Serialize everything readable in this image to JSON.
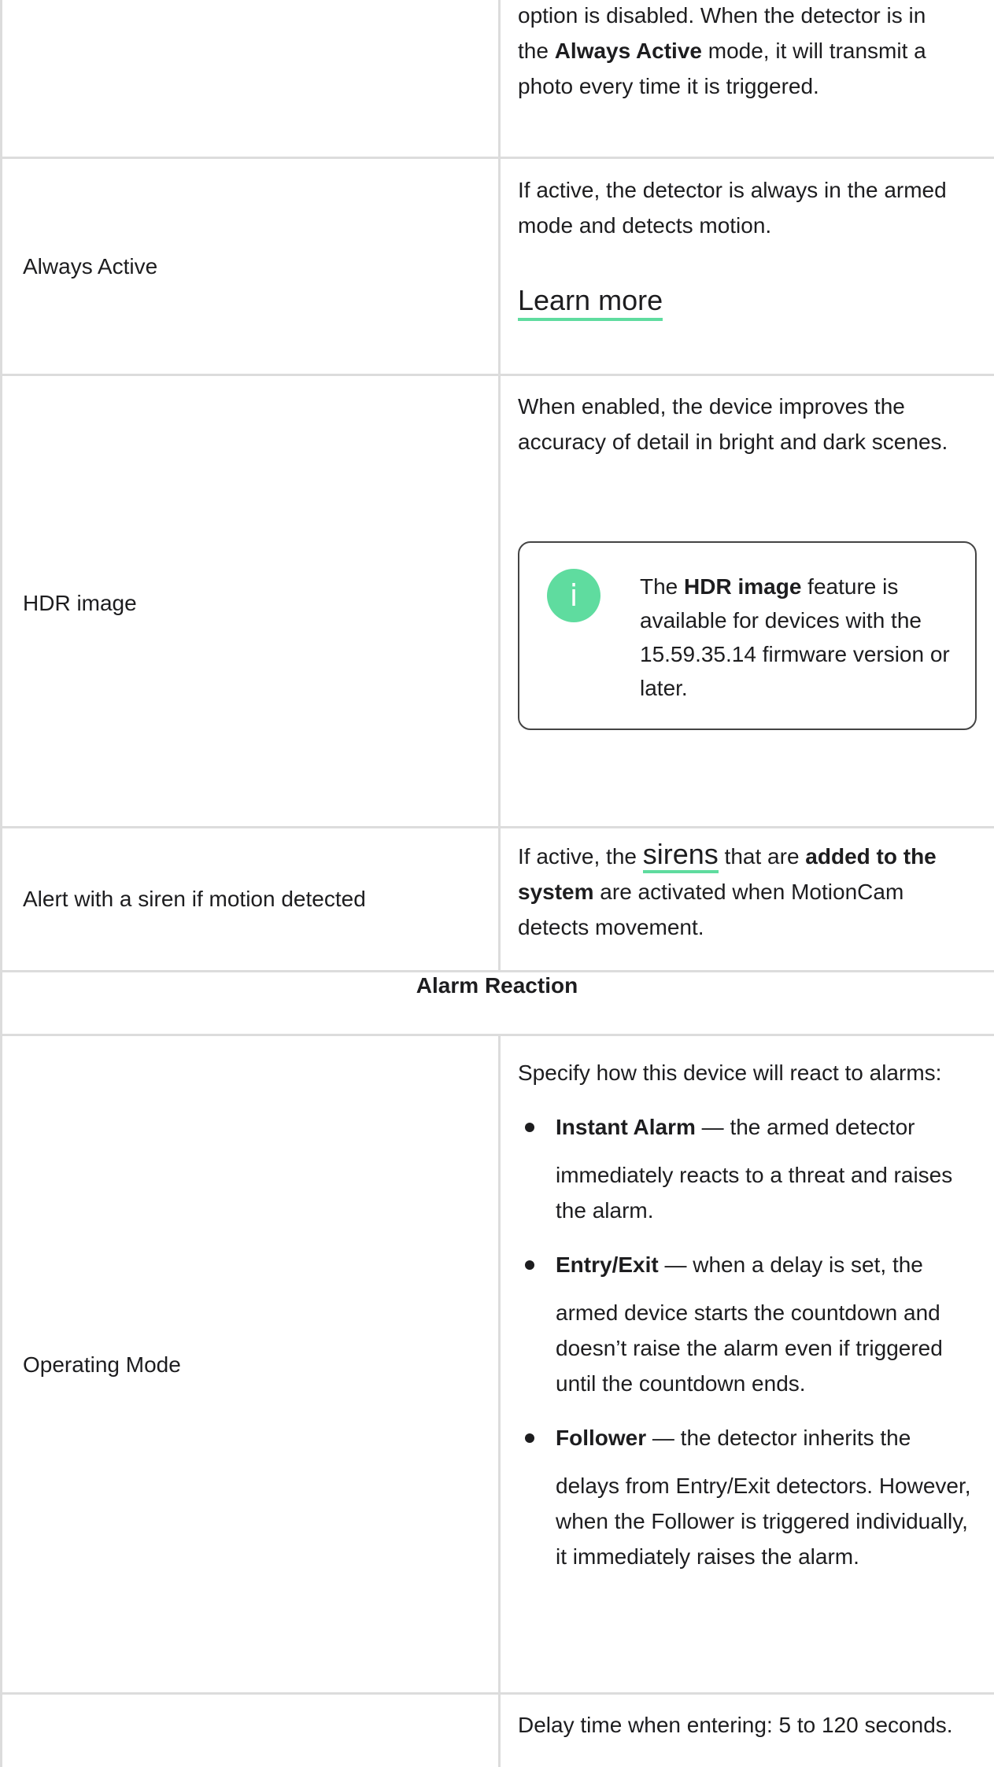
{
  "row_photo_transmission": {
    "desc_line1": "option is disabled. When the detector is in",
    "desc_line2_pre": "the ",
    "desc_line2_bold": "Always Active",
    "desc_line2_post": " mode, it will transmit a",
    "desc_line3": "photo every time it is triggered."
  },
  "row_always_active": {
    "label": "Always Active",
    "desc": "If active, the detector is always in the armed mode and detects motion.",
    "link": "Learn more"
  },
  "row_hdr": {
    "label": "HDR image",
    "desc": "When enabled, the device improves the accuracy of detail in bright and dark scenes.",
    "note_icon": "i",
    "note_pre": "The ",
    "note_bold": "HDR image",
    "note_post": " feature is available for devices with the 15.59.35.14 firmware version or later."
  },
  "row_siren": {
    "label": "Alert with a siren if motion detected",
    "pre": "If active, the ",
    "link": "sirens",
    "mid": " that are ",
    "bold": "added to the system",
    "post": " are activated when MotionCam detects movement."
  },
  "section_header": "Alarm Reaction",
  "row_operating_mode": {
    "label": "Operating Mode",
    "intro": "Specify how this device will react to alarms:",
    "items": [
      {
        "bold": "Instant Alarm",
        "first": " — the armed detector",
        "rest": "immediately reacts to a threat and raises the alarm."
      },
      {
        "bold": "Entry/Exit",
        "first": " — when a delay is set, the",
        "rest": "armed device starts the countdown and doesn’t raise the alarm even if triggered until the countdown ends."
      },
      {
        "bold": "Follower",
        "first": " — the detector inherits the",
        "rest": "delays from Entry/Exit detectors. However, when the Follower is triggered individually, it immediately raises the alarm."
      }
    ]
  },
  "row_delay": {
    "desc": "Delay time when entering: 5 to 120 seconds."
  }
}
